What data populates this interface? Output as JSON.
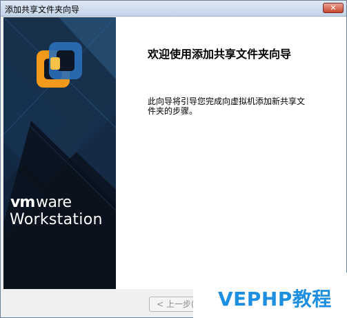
{
  "window": {
    "title": "添加共享文件夹向导",
    "close_glyph": "✕"
  },
  "sidebar": {
    "brand_vm": "vm",
    "brand_ware": "ware",
    "product": "Workstation",
    "logo_icon": "vmware-workstation-logo"
  },
  "main": {
    "heading": "欢迎使用添加共享文件夹向导",
    "description_line1": "此向导将引导您完成向虚拟机添加新共享文",
    "description_line2": "件夹的步骤。"
  },
  "buttons": {
    "back_label": "< 上一步("
  },
  "watermark": {
    "text": "VEPHP教程"
  },
  "colors": {
    "accent_blue": "#1e8fe0",
    "sidebar_dark": "#0c1624",
    "logo_orange": "#f39a1d",
    "logo_blue": "#2a6fb8"
  }
}
